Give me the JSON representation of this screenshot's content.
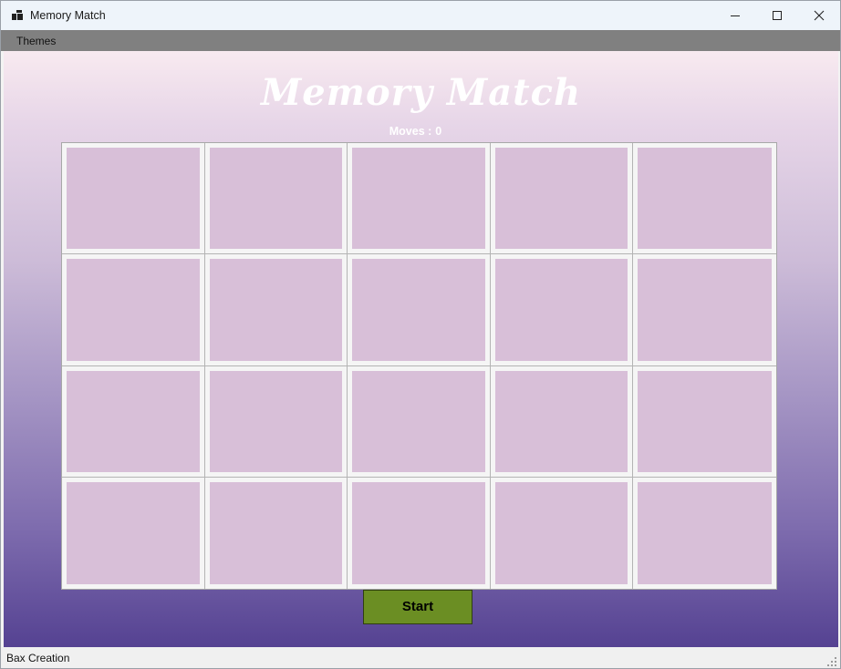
{
  "window": {
    "title": "Memory Match",
    "icon": "app-window-icon",
    "controls": [
      "minimize-icon",
      "maximize-icon",
      "close-icon"
    ]
  },
  "menu": {
    "items": [
      "Themes"
    ]
  },
  "game": {
    "title": "Memory Match",
    "moves_label": "Moves :",
    "moves_value": "0",
    "grid": {
      "rows": 4,
      "cols": 5,
      "card_face": "hidden"
    },
    "start_label": "Start"
  },
  "status": {
    "text": "Bax Creation"
  },
  "colors": {
    "menubar": "#808080",
    "card_back": "#d8bfd8",
    "start_button": "#6b8e23",
    "gradient_top": "#f8eaf0",
    "gradient_bottom": "#554292"
  }
}
